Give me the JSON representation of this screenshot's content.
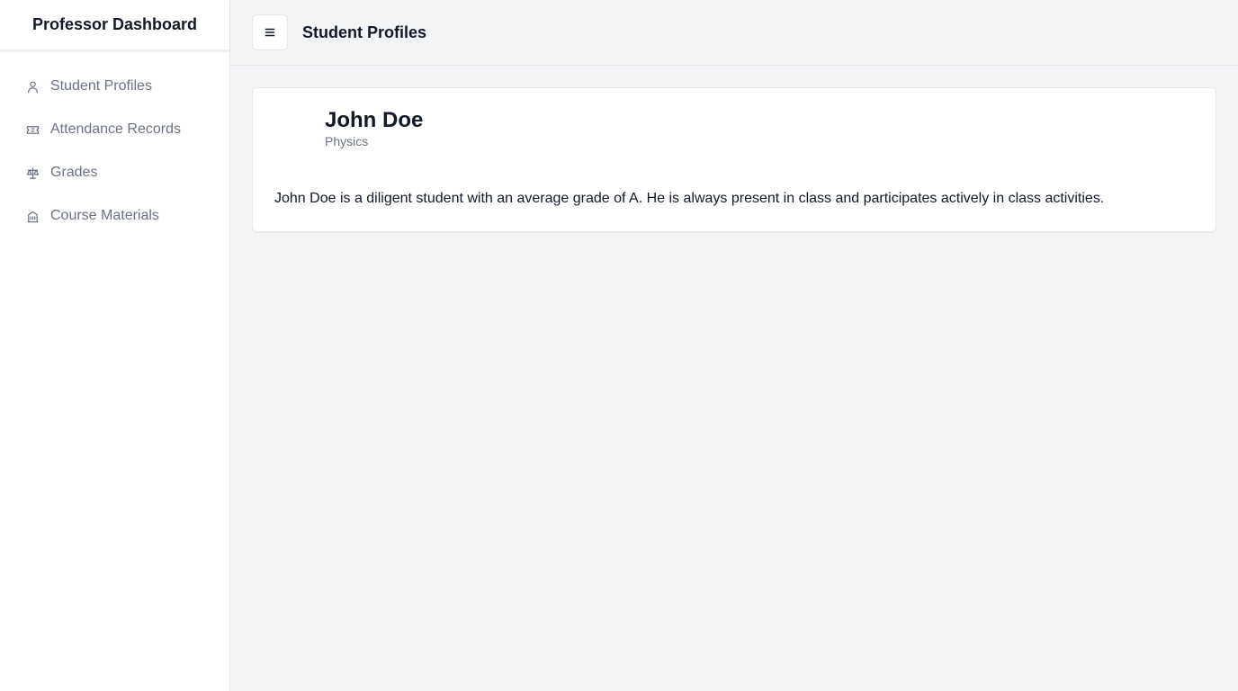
{
  "sidebar": {
    "title": "Professor Dashboard",
    "items": [
      {
        "label": "Student Profiles",
        "icon": "user-icon"
      },
      {
        "label": "Attendance Records",
        "icon": "ticket-icon"
      },
      {
        "label": "Grades",
        "icon": "scale-icon"
      },
      {
        "label": "Course Materials",
        "icon": "building-icon"
      }
    ]
  },
  "header": {
    "menu_icon": "menu-icon",
    "title": "Student Profiles"
  },
  "profile": {
    "name": "John Doe",
    "subject": "Physics",
    "bio": "John Doe is a diligent student with an average grade of A. He is always present in class and participates actively in class activities."
  }
}
